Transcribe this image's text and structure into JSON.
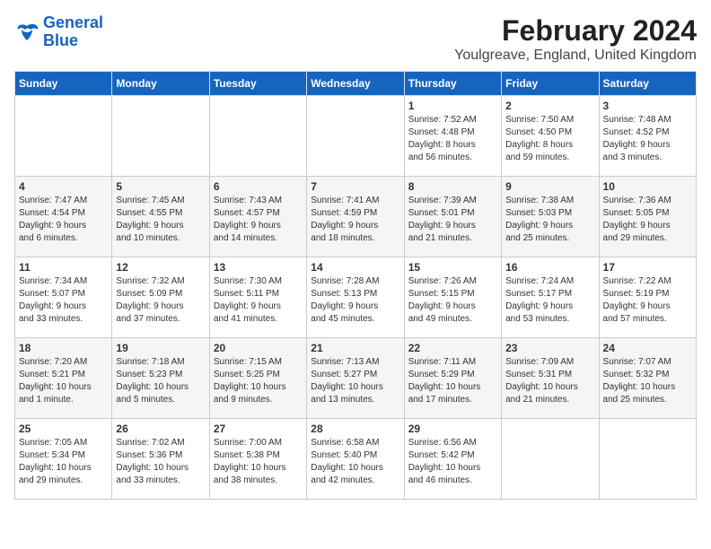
{
  "logo": {
    "line1": "General",
    "line2": "Blue"
  },
  "title": "February 2024",
  "subtitle": "Youlgreave, England, United Kingdom",
  "days_of_week": [
    "Sunday",
    "Monday",
    "Tuesday",
    "Wednesday",
    "Thursday",
    "Friday",
    "Saturday"
  ],
  "weeks": [
    [
      {
        "day": "",
        "info": ""
      },
      {
        "day": "",
        "info": ""
      },
      {
        "day": "",
        "info": ""
      },
      {
        "day": "",
        "info": ""
      },
      {
        "day": "1",
        "info": "Sunrise: 7:52 AM\nSunset: 4:48 PM\nDaylight: 8 hours\nand 56 minutes."
      },
      {
        "day": "2",
        "info": "Sunrise: 7:50 AM\nSunset: 4:50 PM\nDaylight: 8 hours\nand 59 minutes."
      },
      {
        "day": "3",
        "info": "Sunrise: 7:48 AM\nSunset: 4:52 PM\nDaylight: 9 hours\nand 3 minutes."
      }
    ],
    [
      {
        "day": "4",
        "info": "Sunrise: 7:47 AM\nSunset: 4:54 PM\nDaylight: 9 hours\nand 6 minutes."
      },
      {
        "day": "5",
        "info": "Sunrise: 7:45 AM\nSunset: 4:55 PM\nDaylight: 9 hours\nand 10 minutes."
      },
      {
        "day": "6",
        "info": "Sunrise: 7:43 AM\nSunset: 4:57 PM\nDaylight: 9 hours\nand 14 minutes."
      },
      {
        "day": "7",
        "info": "Sunrise: 7:41 AM\nSunset: 4:59 PM\nDaylight: 9 hours\nand 18 minutes."
      },
      {
        "day": "8",
        "info": "Sunrise: 7:39 AM\nSunset: 5:01 PM\nDaylight: 9 hours\nand 21 minutes."
      },
      {
        "day": "9",
        "info": "Sunrise: 7:38 AM\nSunset: 5:03 PM\nDaylight: 9 hours\nand 25 minutes."
      },
      {
        "day": "10",
        "info": "Sunrise: 7:36 AM\nSunset: 5:05 PM\nDaylight: 9 hours\nand 29 minutes."
      }
    ],
    [
      {
        "day": "11",
        "info": "Sunrise: 7:34 AM\nSunset: 5:07 PM\nDaylight: 9 hours\nand 33 minutes."
      },
      {
        "day": "12",
        "info": "Sunrise: 7:32 AM\nSunset: 5:09 PM\nDaylight: 9 hours\nand 37 minutes."
      },
      {
        "day": "13",
        "info": "Sunrise: 7:30 AM\nSunset: 5:11 PM\nDaylight: 9 hours\nand 41 minutes."
      },
      {
        "day": "14",
        "info": "Sunrise: 7:28 AM\nSunset: 5:13 PM\nDaylight: 9 hours\nand 45 minutes."
      },
      {
        "day": "15",
        "info": "Sunrise: 7:26 AM\nSunset: 5:15 PM\nDaylight: 9 hours\nand 49 minutes."
      },
      {
        "day": "16",
        "info": "Sunrise: 7:24 AM\nSunset: 5:17 PM\nDaylight: 9 hours\nand 53 minutes."
      },
      {
        "day": "17",
        "info": "Sunrise: 7:22 AM\nSunset: 5:19 PM\nDaylight: 9 hours\nand 57 minutes."
      }
    ],
    [
      {
        "day": "18",
        "info": "Sunrise: 7:20 AM\nSunset: 5:21 PM\nDaylight: 10 hours\nand 1 minute."
      },
      {
        "day": "19",
        "info": "Sunrise: 7:18 AM\nSunset: 5:23 PM\nDaylight: 10 hours\nand 5 minutes."
      },
      {
        "day": "20",
        "info": "Sunrise: 7:15 AM\nSunset: 5:25 PM\nDaylight: 10 hours\nand 9 minutes."
      },
      {
        "day": "21",
        "info": "Sunrise: 7:13 AM\nSunset: 5:27 PM\nDaylight: 10 hours\nand 13 minutes."
      },
      {
        "day": "22",
        "info": "Sunrise: 7:11 AM\nSunset: 5:29 PM\nDaylight: 10 hours\nand 17 minutes."
      },
      {
        "day": "23",
        "info": "Sunrise: 7:09 AM\nSunset: 5:31 PM\nDaylight: 10 hours\nand 21 minutes."
      },
      {
        "day": "24",
        "info": "Sunrise: 7:07 AM\nSunset: 5:32 PM\nDaylight: 10 hours\nand 25 minutes."
      }
    ],
    [
      {
        "day": "25",
        "info": "Sunrise: 7:05 AM\nSunset: 5:34 PM\nDaylight: 10 hours\nand 29 minutes."
      },
      {
        "day": "26",
        "info": "Sunrise: 7:02 AM\nSunset: 5:36 PM\nDaylight: 10 hours\nand 33 minutes."
      },
      {
        "day": "27",
        "info": "Sunrise: 7:00 AM\nSunset: 5:38 PM\nDaylight: 10 hours\nand 38 minutes."
      },
      {
        "day": "28",
        "info": "Sunrise: 6:58 AM\nSunset: 5:40 PM\nDaylight: 10 hours\nand 42 minutes."
      },
      {
        "day": "29",
        "info": "Sunrise: 6:56 AM\nSunset: 5:42 PM\nDaylight: 10 hours\nand 46 minutes."
      },
      {
        "day": "",
        "info": ""
      },
      {
        "day": "",
        "info": ""
      }
    ]
  ]
}
